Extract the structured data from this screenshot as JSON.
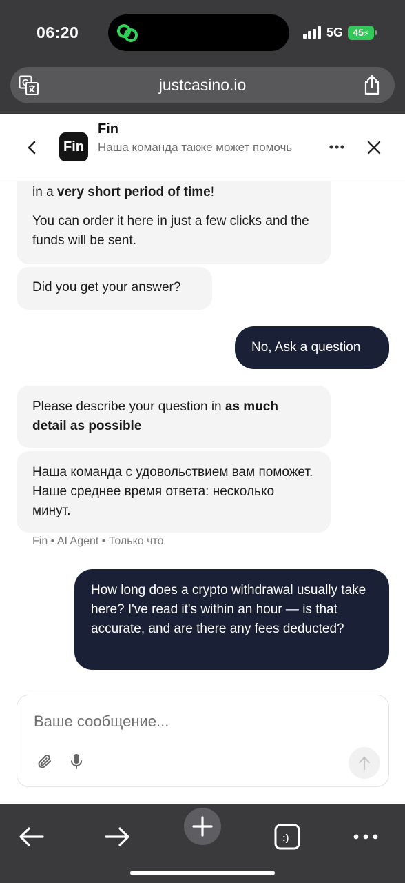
{
  "status": {
    "time": "06:20",
    "network": "5G",
    "battery": "45"
  },
  "browser": {
    "url": "justcasino.io",
    "icons": [
      "translate-icon",
      "share-icon",
      "back-arrow-icon",
      "forward-arrow-icon",
      "new-tab-icon",
      "tabs-icon",
      "more-icon"
    ],
    "tabs_badge": ":)"
  },
  "chat_header": {
    "logo_text": "Fin",
    "agent_name": "Fin",
    "subtitle": "Наша команда также может помочь"
  },
  "messages": [
    {
      "from": "bot",
      "line1_prefix": "in a ",
      "line1_bold": "very short period of time",
      "line1_suffix": "!",
      "line2_prefix": "You can order it ",
      "line2_link": "here",
      "line2_suffix": " in just a few clicks and the funds will be sent."
    },
    {
      "from": "bot",
      "text": "Did you get your answer?"
    },
    {
      "from": "user",
      "text": "No, Ask a question"
    },
    {
      "from": "bot",
      "prefix": "Please describe your question in ",
      "bold": "as much detail as possible"
    },
    {
      "from": "bot",
      "text": "Наша команда с удовольствием вам поможет. Наше среднее время ответа: несколько минут."
    },
    {
      "from": "user",
      "text": "How long does a crypto withdrawal usually take here? I've read it's within an hour — is that accurate, and are there any fees deducted?"
    }
  ],
  "message_meta": "Fin • AI Agent • Только что",
  "composer": {
    "placeholder": "Ваше сообщение..."
  },
  "colors": {
    "chrome": "#3a3a3c",
    "user_bubble": "#1a2035",
    "bot_bubble": "#f4f4f5",
    "battery": "#34c759",
    "island_icon": "#30d158"
  }
}
